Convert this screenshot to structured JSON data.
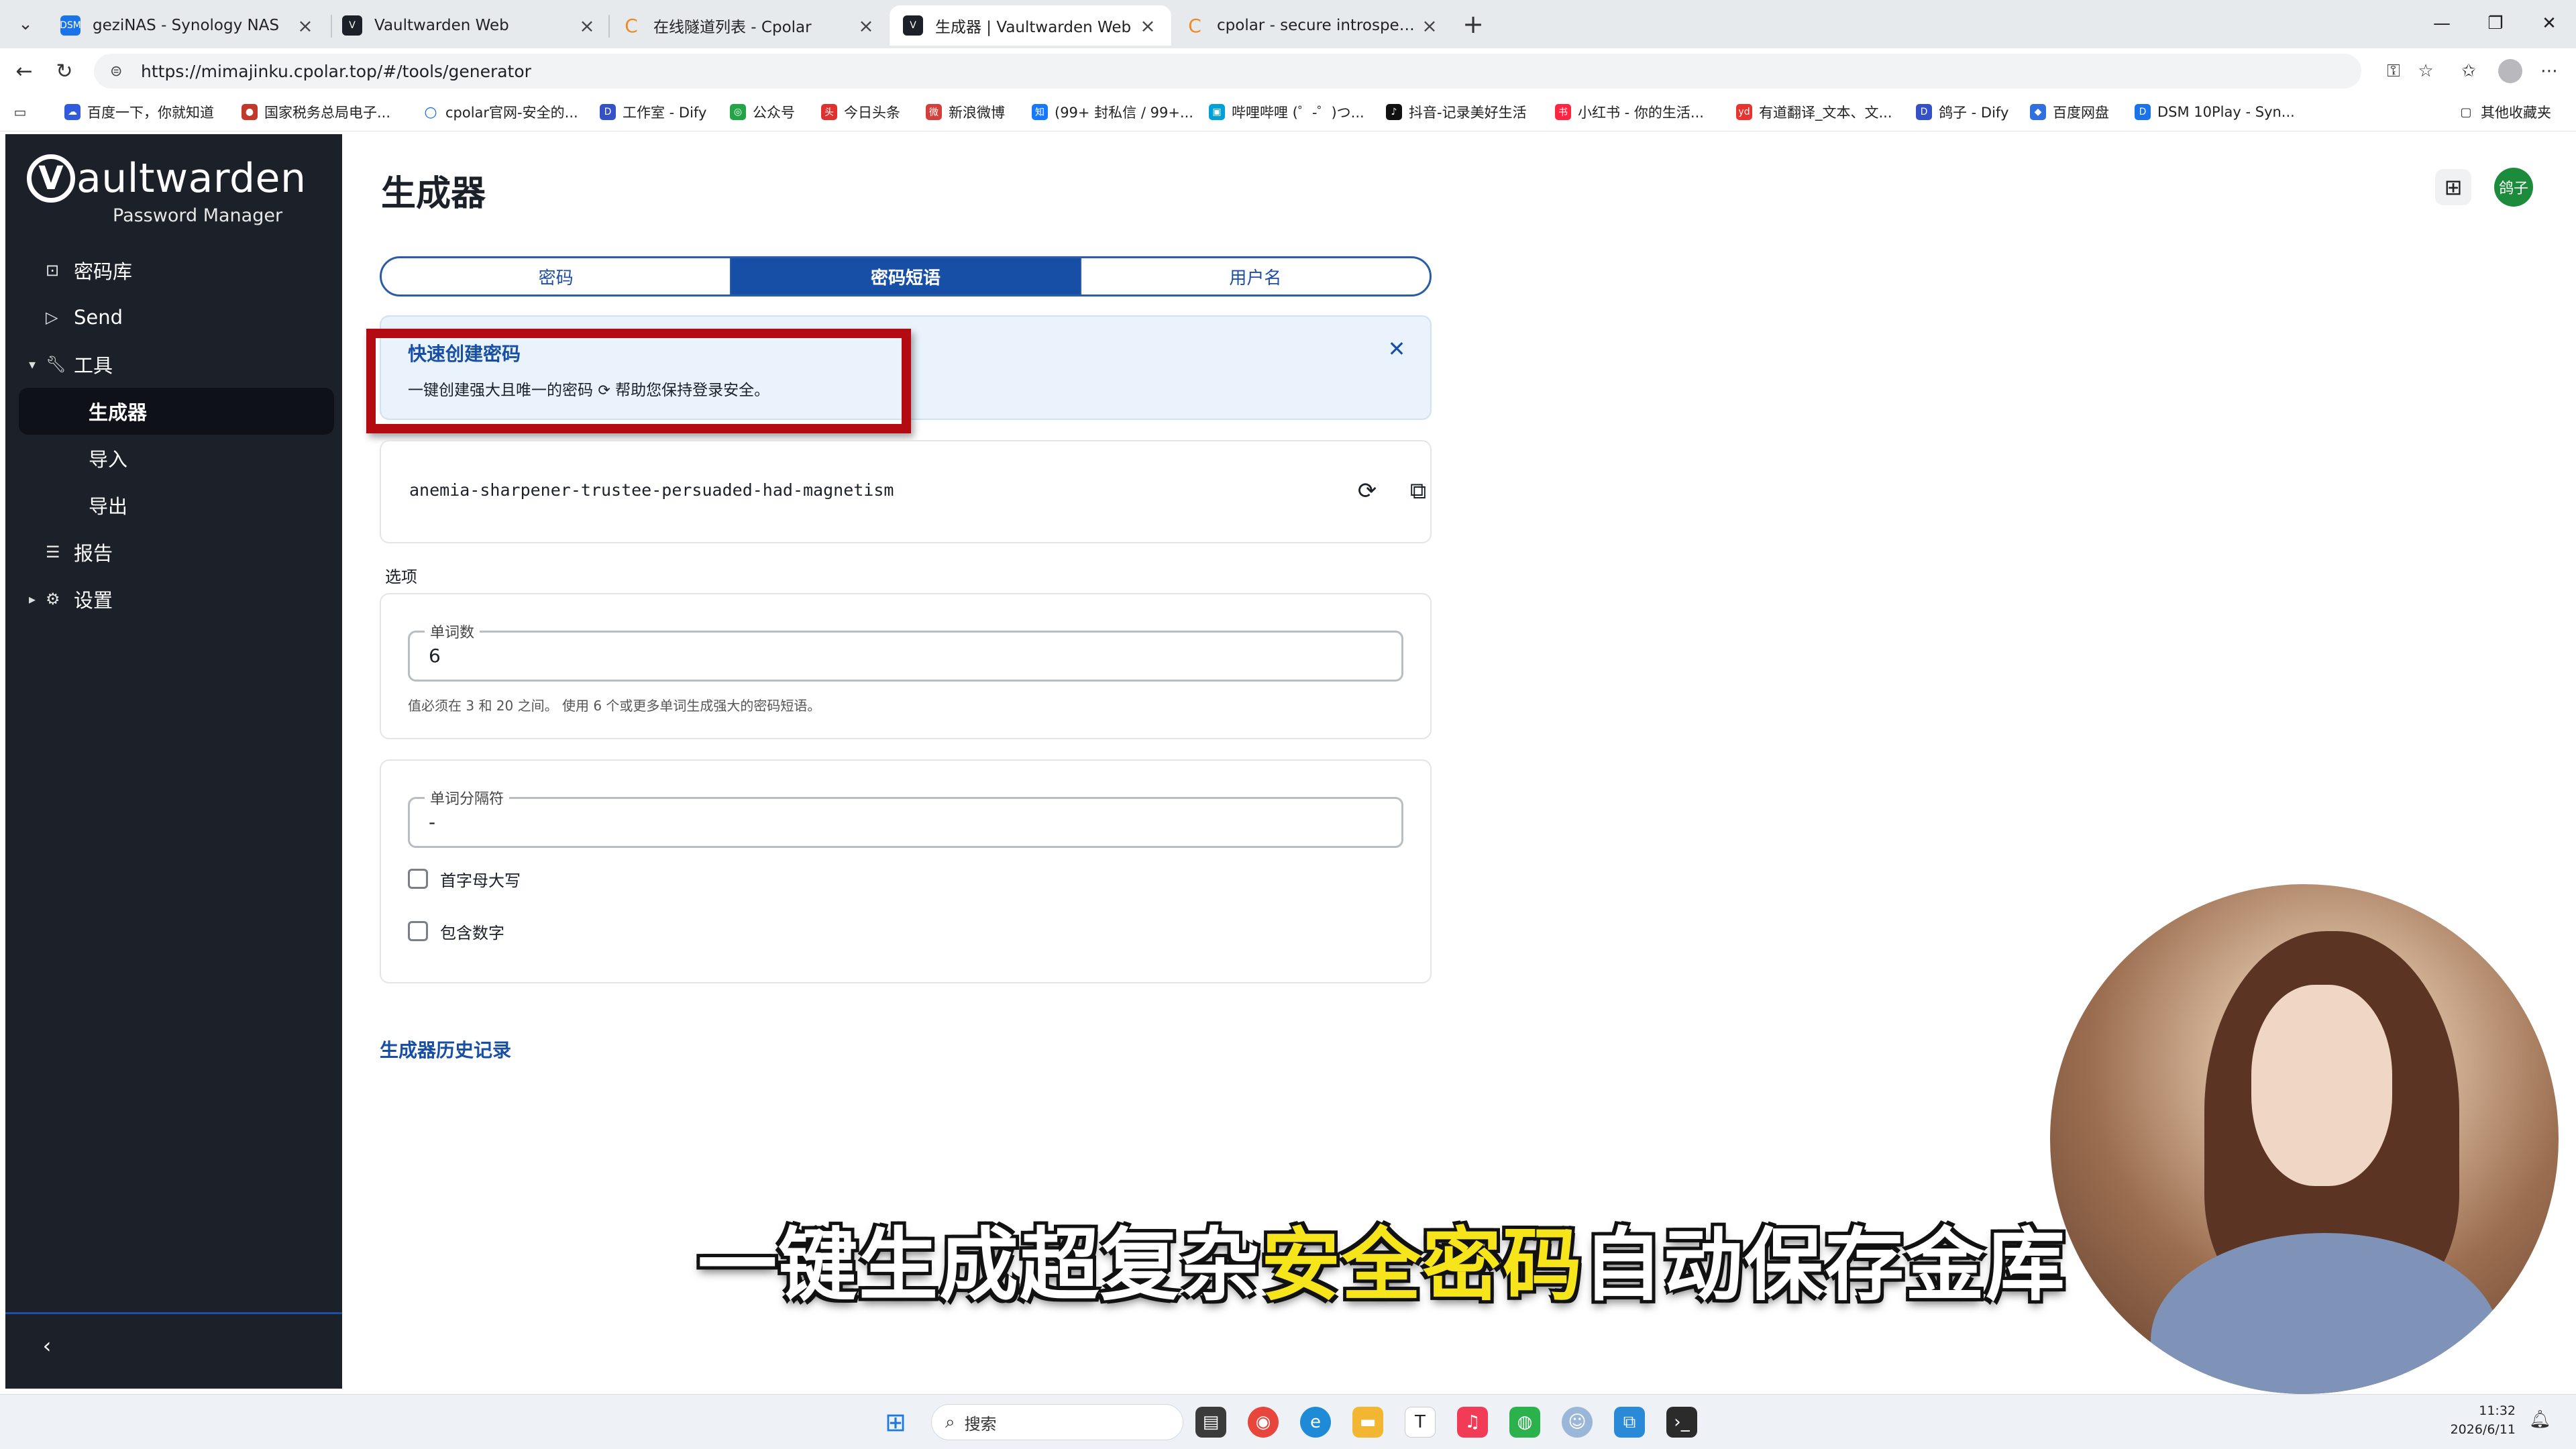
{
  "browser": {
    "tabs": [
      {
        "title": "geziNAS - Synology NAS",
        "favicon": "dsm-icon",
        "color": "#1a73e8"
      },
      {
        "title": "Vaultwarden Web",
        "favicon": "vaultwarden-icon",
        "color": "#1b2029"
      },
      {
        "title": "在线隧道列表 - Cpolar",
        "favicon": "cpolar-icon",
        "color": "#f08a24"
      },
      {
        "title": "生成器 | Vaultwarden Web",
        "favicon": "vaultwarden-icon",
        "color": "#1b2029"
      },
      {
        "title": "cpolar - secure introspectable tunn",
        "favicon": "cpolar-icon",
        "color": "#f08a24"
      }
    ],
    "url": "https://mimajinku.cpolar.top/#/tools/generator",
    "bookmarks": [
      "百度一下，你就知道",
      "国家税务总局电子...",
      "cpolar官网-安全的...",
      "工作室 - Dify",
      "公众号",
      "今日头条",
      "新浪微博",
      "(99+ 封私信 / 99+...",
      "哔哩哔哩 (゜-゜)つ...",
      "抖音-记录美好生活",
      "小红书 - 你的生活...",
      "有道翻译_文本、文...",
      "鸽子 - Dify",
      "百度网盘",
      "DSM 10Play - Syn...",
      "其他收藏夹"
    ]
  },
  "app": {
    "logo_word": "aultwarden",
    "logo_letter": "V",
    "logo_sub": "Password Manager",
    "nav": [
      {
        "label": "密码库",
        "icon": "vault-icon"
      },
      {
        "label": "Send",
        "icon": "send-icon"
      },
      {
        "label": "工具",
        "icon": "wrench-icon"
      },
      {
        "label": "生成器"
      },
      {
        "label": "导入"
      },
      {
        "label": "导出"
      },
      {
        "label": "报告",
        "icon": "sliders-icon"
      },
      {
        "label": "设置",
        "icon": "gear-icon"
      }
    ],
    "page_title": "生成器",
    "avatar_initials": "鸽子",
    "segments": [
      "密码",
      "密码短语",
      "用户名"
    ],
    "callout": {
      "title": "快速创建密码",
      "body_before": "一键创建强大且唯一的密码",
      "body_after": "帮助您保持登录安全。"
    },
    "generated_value": "anemia-sharpener-trustee-persuaded-had-magnetism",
    "options_label": "选项",
    "word_count": {
      "label": "单词数",
      "value": "6",
      "hint": "值必须在 3 和 20 之间。 使用 6 个或更多单词生成强大的密码短语。"
    },
    "separator": {
      "label": "单词分隔符",
      "value": "-"
    },
    "checkboxes": [
      {
        "label": "首字母大写",
        "checked": false
      },
      {
        "label": "包含数字",
        "checked": false
      }
    ],
    "history_link": "生成器历史记录"
  },
  "overlay": {
    "subtitle_pre": "一键生成超复杂",
    "subtitle_highlight": "安全密码",
    "subtitle_post": "自动保存金库"
  },
  "taskbar": {
    "search_placeholder": "搜索",
    "time": "11:32",
    "date": "2026/6/11"
  },
  "colors": {
    "sidebar_bg": "#1b2029",
    "accent": "#174ea6",
    "highlight_red": "#b40b12",
    "subtitle_yellow": "#f7e51c"
  }
}
